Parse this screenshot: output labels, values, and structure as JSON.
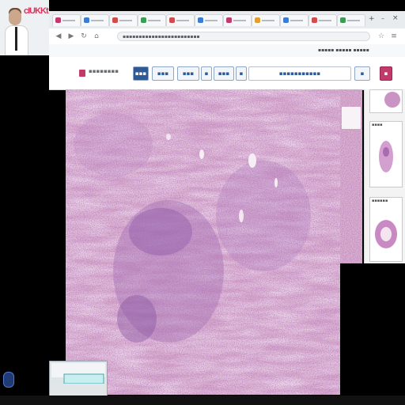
{
  "webcam": {
    "banner_text": "cIUKKt"
  },
  "browser": {
    "tab_count": 11,
    "address_text": "▪▪▪▪▪▪▪▪▪▪▪▪▪▪▪▪▪▪▪▪▪▪▪▪",
    "bookmarks_text": "▪▪▪▪▪ ▪▪▪▪▪ ▪▪▪▪▪"
  },
  "viewer_toolbar": {
    "brand_label": "▪▪▪▪▪▪▪▪",
    "buttons": [
      "▪▪▪",
      "▪▪▪",
      "▪▪▪",
      "▪",
      "▪▪▪",
      "▪",
      "▪▪▪▪▪▪▪▪▪▪▪",
      "▪",
      "▪"
    ]
  },
  "thumbnails": {
    "items": [
      {
        "label": ""
      },
      {
        "label": "▪▪▪▪"
      },
      {
        "label": "▪▪▪▪▪▪"
      }
    ]
  },
  "colors": {
    "tissue_base": "#d9a9cc",
    "nuclei": "#5a2a76",
    "stroma": "#e8c6de",
    "accent": "#c23a6a",
    "button_blue": "#2d5a96"
  },
  "icons": [
    "back-icon",
    "forward-icon",
    "reload-icon",
    "home-icon",
    "windows-start-icon"
  ]
}
